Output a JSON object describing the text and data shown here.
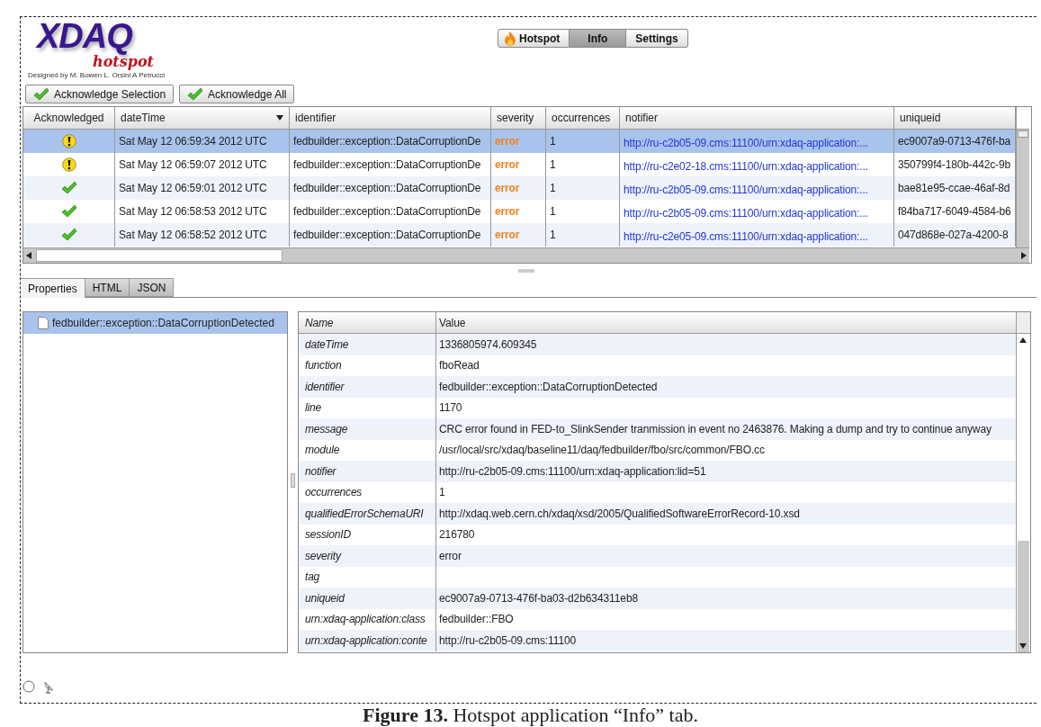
{
  "logo": {
    "title": "XDAQ",
    "subtitle": "hotspot",
    "credit": "Designed by M. Bowen L. Orsini A Petrucci"
  },
  "nav_tabs": [
    {
      "label": "Hotspot",
      "selected": false,
      "kind": "flame"
    },
    {
      "label": "Info",
      "selected": true,
      "kind": "plain"
    },
    {
      "label": "Settings",
      "selected": false,
      "kind": "plain"
    }
  ],
  "actions": [
    "Acknowledge Selection",
    "Acknowledge All"
  ],
  "table": {
    "columns": [
      {
        "label": "Acknowledged",
        "sorted": false
      },
      {
        "label": "dateTime",
        "sorted": true
      },
      {
        "label": "identifier",
        "sorted": false
      },
      {
        "label": "severity",
        "sorted": false
      },
      {
        "label": "occurrences",
        "sorted": false
      },
      {
        "label": "notifier",
        "sorted": false
      },
      {
        "label": "uniqueid",
        "sorted": false
      }
    ],
    "rows": [
      {
        "acknowledged": false,
        "selected": true,
        "dateTime": "Sat May 12 06:59:34 2012 UTC",
        "identifier": "fedbuilder::exception::DataCorruptionDe",
        "severity": "error",
        "occurrences": "1",
        "notifier": "http://ru-c2b05-09.cms:11100/urn:xdaq-application:...",
        "uniqueid": "ec9007a9-0713-476f-ba"
      },
      {
        "acknowledged": false,
        "selected": false,
        "dateTime": "Sat May 12 06:59:07 2012 UTC",
        "identifier": "fedbuilder::exception::DataCorruptionDe",
        "severity": "error",
        "occurrences": "1",
        "notifier": "http://ru-c2e02-18.cms:11100/urn:xdaq-application:...",
        "uniqueid": "350799f4-180b-442c-9b"
      },
      {
        "acknowledged": true,
        "selected": false,
        "dateTime": "Sat May 12 06:59:01 2012 UTC",
        "identifier": "fedbuilder::exception::DataCorruptionDe",
        "severity": "error",
        "occurrences": "1",
        "notifier": "http://ru-c2b05-09.cms:11100/urn:xdaq-application:...",
        "uniqueid": "bae81e95-ccae-46af-8d"
      },
      {
        "acknowledged": true,
        "selected": false,
        "dateTime": "Sat May 12 06:58:53 2012 UTC",
        "identifier": "fedbuilder::exception::DataCorruptionDe",
        "severity": "error",
        "occurrences": "1",
        "notifier": "http://ru-c2b05-09.cms:11100/urn:xdaq-application:...",
        "uniqueid": "f84ba717-6049-4584-b6"
      },
      {
        "acknowledged": true,
        "selected": false,
        "dateTime": "Sat May 12 06:58:52 2012 UTC",
        "identifier": "fedbuilder::exception::DataCorruptionDe",
        "severity": "error",
        "occurrences": "1",
        "notifier": "http://ru-c2e05-09.cms:11100/urn:xdaq-application:...",
        "uniqueid": "047d868e-027a-4200-8"
      }
    ]
  },
  "detail_tabs": [
    {
      "label": "Properties",
      "selected": true
    },
    {
      "label": "HTML",
      "selected": false
    },
    {
      "label": "JSON",
      "selected": false
    }
  ],
  "tree": [
    {
      "label": "fedbuilder::exception::DataCorruptionDetected",
      "selected": true
    }
  ],
  "properties": {
    "columns": [
      "Name",
      "Value"
    ],
    "rows": [
      {
        "name": "dateTime",
        "value": "1336805974.609345"
      },
      {
        "name": "function",
        "value": "fboRead"
      },
      {
        "name": "identifier",
        "value": "fedbuilder::exception::DataCorruptionDetected"
      },
      {
        "name": "line",
        "value": "1170"
      },
      {
        "name": "message",
        "value": "CRC error found in FED-to_SlinkSender tranmission in event no 2463876. Making a dump and try to continue anyway"
      },
      {
        "name": "module",
        "value": "/usr/local/src/xdaq/baseline11/daq/fedbuilder/fbo/src/common/FBO.cc"
      },
      {
        "name": "notifier",
        "value": "http://ru-c2b05-09.cms:11100/urn:xdaq-application:lid=51"
      },
      {
        "name": "occurrences",
        "value": "1"
      },
      {
        "name": "qualifiedErrorSchemaURI",
        "value": "http://xdaq.web.cern.ch/xdaq/xsd/2005/QualifiedSoftwareErrorRecord-10.xsd"
      },
      {
        "name": "sessionID",
        "value": "216780"
      },
      {
        "name": "severity",
        "value": "error"
      },
      {
        "name": "tag",
        "value": ""
      },
      {
        "name": "uniqueid",
        "value": "ec9007a9-0713-476f-ba03-d2b634311eb8"
      },
      {
        "name": "urn:xdaq-application:class",
        "value": "fedbuilder::FBO"
      },
      {
        "name": "urn:xdaq-application:conte",
        "value": "http://ru-c2b05-09.cms:11100"
      }
    ]
  },
  "caption": "**Figure 13.** Hotspot application “Info” tab."
}
